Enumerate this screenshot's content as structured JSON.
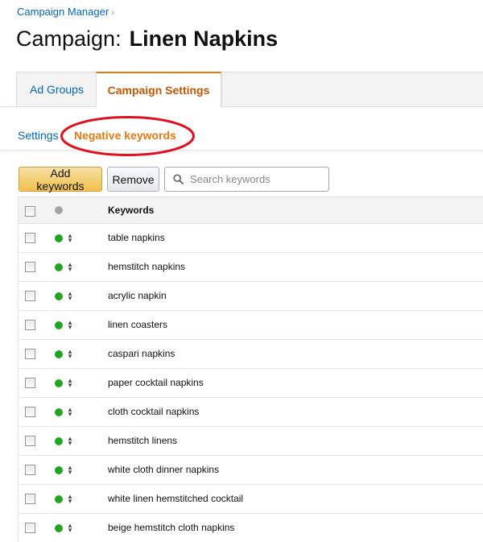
{
  "breadcrumb": {
    "label": "Campaign Manager",
    "separator": "›"
  },
  "page": {
    "title_prefix": "Campaign:",
    "title_name": "Linen Napkins"
  },
  "tabs": [
    {
      "label": "Ad Groups",
      "active": false
    },
    {
      "label": "Campaign Settings",
      "active": true
    }
  ],
  "subnav": {
    "items": [
      {
        "label": "Settings",
        "active": false
      },
      {
        "label": "Negative keywords",
        "active": true,
        "highlighted": true
      }
    ]
  },
  "toolbar": {
    "add_label": "Add keywords",
    "remove_label": "Remove",
    "search_placeholder": "Search keywords",
    "search_value": ""
  },
  "table": {
    "header": {
      "keywords_label": "Keywords",
      "status_icon": "status-dot-gray"
    },
    "rows": [
      {
        "keyword": "table napkins",
        "status": "active"
      },
      {
        "keyword": "hemstitch napkins",
        "status": "active"
      },
      {
        "keyword": "acrylic napkin",
        "status": "active"
      },
      {
        "keyword": "linen coasters",
        "status": "active"
      },
      {
        "keyword": "caspari napkins",
        "status": "active"
      },
      {
        "keyword": "paper cocktail napkins",
        "status": "active"
      },
      {
        "keyword": "cloth cocktail napkins",
        "status": "active"
      },
      {
        "keyword": "hemstitch linens",
        "status": "active"
      },
      {
        "keyword": "white cloth dinner napkins",
        "status": "active"
      },
      {
        "keyword": "white linen hemstitched cocktail",
        "status": "active"
      },
      {
        "keyword": "beige hemstitch cloth napkins",
        "status": "active"
      }
    ]
  },
  "colors": {
    "link": "#0066c0",
    "active_tab": "#c45500",
    "active_subnav": "#e47911",
    "status_active": "#1fa51f",
    "highlight_ring": "#e0101e",
    "primary_button": "#f0c14b"
  }
}
